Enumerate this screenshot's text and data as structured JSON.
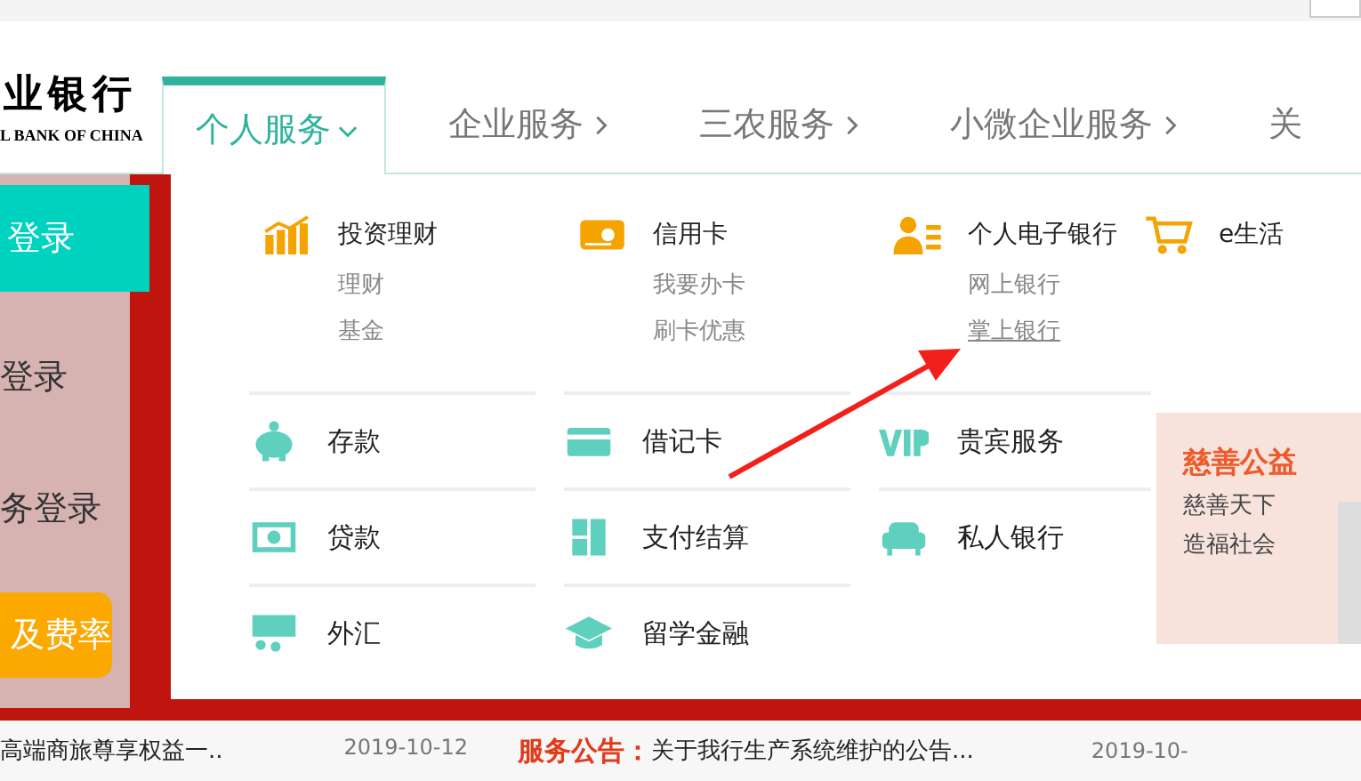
{
  "header": {
    "logo_cn": "业银行",
    "logo_en": "L BANK OF CHINA"
  },
  "nav": [
    {
      "label": "个人服务",
      "selected": true,
      "kind": "open"
    },
    {
      "label": "企业服务",
      "selected": false,
      "kind": "closed"
    },
    {
      "label": "三农服务",
      "selected": false,
      "kind": "closed"
    },
    {
      "label": "小微企业服务",
      "selected": false,
      "kind": "closed"
    },
    {
      "label": "关",
      "selected": false,
      "kind": "cut"
    }
  ],
  "login_panel": [
    {
      "label": "登录",
      "kind": "primary"
    },
    {
      "label": "登录",
      "kind": "plain"
    },
    {
      "label": "务登录",
      "kind": "plain"
    },
    {
      "label": "及费率",
      "kind": "accent"
    }
  ],
  "menu": {
    "featured": [
      {
        "title": "投资理财",
        "links": [
          {
            "label": "理财",
            "hovered": false
          },
          {
            "label": "基金",
            "hovered": false
          }
        ]
      },
      {
        "title": "信用卡",
        "links": [
          {
            "label": "我要办卡",
            "hovered": false
          },
          {
            "label": "刷卡优惠",
            "hovered": false
          }
        ]
      },
      {
        "title": "个人电子银行",
        "links": [
          {
            "label": "网上银行",
            "hovered": false
          },
          {
            "label": "掌上银行",
            "hovered": true
          }
        ]
      },
      {
        "title": "e生活"
      }
    ],
    "rows": [
      [
        "存款",
        "借记卡",
        "贵宾服务"
      ],
      [
        "贷款",
        "支付结算",
        "私人银行"
      ],
      [
        "外汇",
        "留学金融"
      ]
    ],
    "promo": {
      "title": "慈善公益",
      "lines": [
        "慈善天下",
        "造福社会"
      ]
    }
  },
  "news": [
    {
      "text": "高端商旅尊享权益一..",
      "date": "2019-10-12"
    }
  ],
  "announcement": {
    "label": "服务公告：",
    "text": "关于我行生产系统维护的公告...",
    "date": "2019-10-"
  }
}
